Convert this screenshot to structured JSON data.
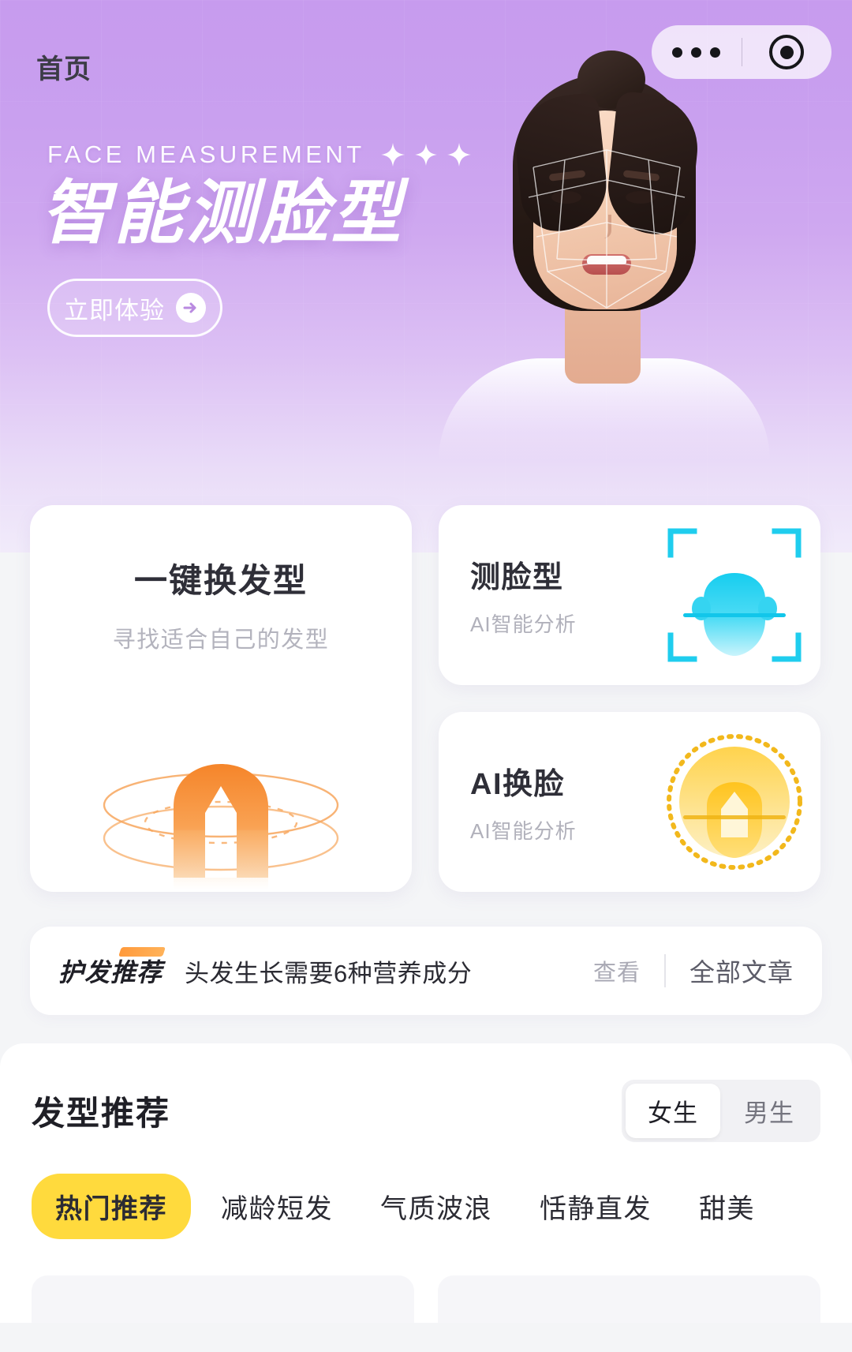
{
  "nav": {
    "title": "首页",
    "capsule": {
      "menu_icon": "more-dots-icon",
      "close_icon": "target-circle-icon"
    }
  },
  "hero": {
    "eyebrow_en": "FACE MEASUREMENT",
    "sparkle_icon": "sparkle-diamond-icon",
    "sparkle_count": 3,
    "title": "智能测脸型",
    "cta_label": "立即体验",
    "cta_icon": "arrow-right-circle-icon",
    "model_image": "woman-face-scan-photo",
    "bg_gradient_top": "#c79bee",
    "bg_gradient_bottom": "#f1ebfa"
  },
  "feature_cards": {
    "primary": {
      "title": "一键换发型",
      "subtitle": "寻找适合自己的发型",
      "art_icon": "hairstyle-orbit-icon",
      "accent": "#f5932f"
    },
    "secondary": [
      {
        "title": "测脸型",
        "subtitle": "AI智能分析",
        "art_icon": "face-scan-bracket-icon",
        "accent": "#22cdf0"
      },
      {
        "title": "AI换脸",
        "subtitle": "AI智能分析",
        "art_icon": "face-swap-badge-icon",
        "accent": "#ffc629"
      }
    ]
  },
  "article_bar": {
    "tag": "护发推荐",
    "title": "头发生长需要6种营养成分",
    "view_label": "查看",
    "all_label": "全部文章",
    "tag_accent": "#ff9a3c"
  },
  "recommend": {
    "title": "发型推荐",
    "gender_options": [
      {
        "label": "女生",
        "active": true
      },
      {
        "label": "男生",
        "active": false
      }
    ],
    "tabs": [
      {
        "label": "热门推荐",
        "active": true
      },
      {
        "label": "减龄短发",
        "active": false
      },
      {
        "label": "气质波浪",
        "active": false
      },
      {
        "label": "恬静直发",
        "active": false
      },
      {
        "label": "甜美",
        "active": false
      }
    ],
    "active_tab_color": "#ffda3d"
  }
}
